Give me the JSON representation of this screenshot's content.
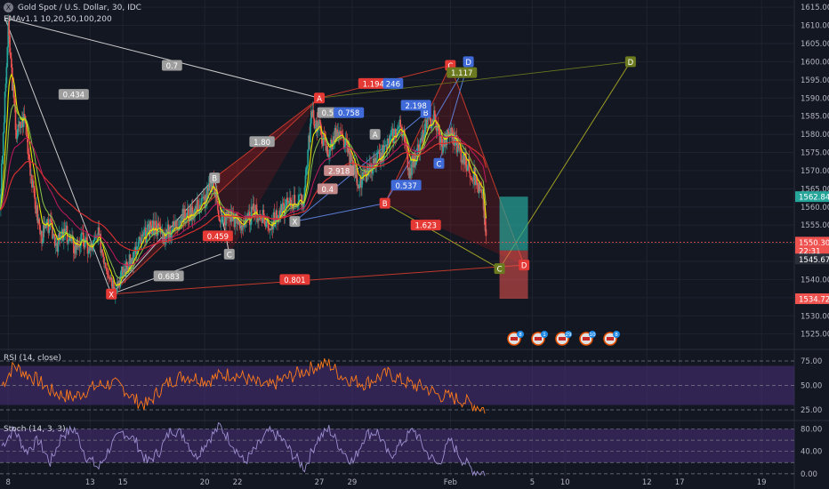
{
  "header": {
    "symbol_line": "Gold Spot / U.S. Dollar, 30, IDC",
    "symbol_logo_letter": "X",
    "ema_line": "EMAv1.1 10,20,50,100,200"
  },
  "colors": {
    "background": "#131722",
    "bull": "#26a69a",
    "bear": "#ef5350",
    "ema_fast": "#e6e600",
    "ema_mid": "#8bc34a",
    "ema_slow": "#d32f2f",
    "rsi_line": "#ff7a1a",
    "stoch_line": "#9c8fd0",
    "band": "#4a2f7a"
  },
  "chart_data": [
    {
      "type": "line",
      "title": "Gold Spot / U.S. Dollar, 30, IDC",
      "y_axis_ticks": [
        1525,
        1530,
        1535,
        1540,
        1545,
        1550,
        1555,
        1560,
        1565,
        1570,
        1575,
        1580,
        1585,
        1590,
        1595,
        1600,
        1605,
        1610,
        1615
      ],
      "y_axis_tick_labels": [
        "1525.00",
        "1530.00",
        "1535.00",
        "1540.00",
        "1545.00",
        "1550.00",
        "1555.00",
        "1560.00",
        "1565.00",
        "1570.00",
        "1575.00",
        "1580.00",
        "1585.00",
        "1590.00",
        "1595.00",
        "1600.00",
        "1605.00",
        "1610.00",
        "1615.00"
      ],
      "ylim": [
        1521,
        1617
      ],
      "x_axis_ticks": [
        8,
        13,
        15,
        20,
        22,
        27,
        29,
        35,
        40,
        42,
        47,
        49,
        54
      ],
      "x_axis_tick_labels": [
        "8",
        "13",
        "15",
        "20",
        "22",
        "27",
        "29",
        "Feb",
        "5",
        "10",
        "12",
        "17",
        "19"
      ],
      "xlim": [
        7.5,
        56
      ],
      "price_close": [
        [
          7.5,
          1560
        ],
        [
          8,
          1609
        ],
        [
          8.5,
          1580
        ],
        [
          9,
          1585
        ],
        [
          9.5,
          1565
        ],
        [
          10,
          1552
        ],
        [
          10.5,
          1555
        ],
        [
          11,
          1550
        ],
        [
          11.5,
          1553
        ],
        [
          12,
          1549
        ],
        [
          12.5,
          1551
        ],
        [
          13,
          1548
        ],
        [
          13.5,
          1552
        ],
        [
          14,
          1544
        ],
        [
          14.5,
          1538
        ],
        [
          15,
          1542
        ],
        [
          15.5,
          1545
        ],
        [
          16,
          1550
        ],
        [
          16.5,
          1553
        ],
        [
          17,
          1555
        ],
        [
          17.5,
          1552
        ],
        [
          18,
          1554
        ],
        [
          18.5,
          1557
        ],
        [
          19,
          1558
        ],
        [
          19.5,
          1560
        ],
        [
          20,
          1562
        ],
        [
          20.5,
          1567
        ],
        [
          21,
          1556
        ],
        [
          21.5,
          1558
        ],
        [
          22,
          1556
        ],
        [
          22.5,
          1555
        ],
        [
          23,
          1559
        ],
        [
          23.5,
          1557
        ],
        [
          24,
          1555
        ],
        [
          24.5,
          1558
        ],
        [
          25,
          1560
        ],
        [
          25.5,
          1562
        ],
        [
          26,
          1561
        ],
        [
          26.5,
          1585
        ],
        [
          27,
          1582
        ],
        [
          27.5,
          1575
        ],
        [
          28,
          1580
        ],
        [
          28.5,
          1578
        ],
        [
          29,
          1572
        ],
        [
          29.5,
          1566
        ],
        [
          30,
          1570
        ],
        [
          30.5,
          1572
        ],
        [
          31,
          1576
        ],
        [
          31.5,
          1580
        ],
        [
          32,
          1583
        ],
        [
          32.5,
          1570
        ],
        [
          33,
          1575
        ],
        [
          33.5,
          1582
        ],
        [
          34,
          1585
        ],
        [
          34.5,
          1577
        ],
        [
          35,
          1581
        ],
        [
          35.5,
          1576
        ],
        [
          36,
          1572
        ],
        [
          36.5,
          1568
        ],
        [
          37,
          1562
        ],
        [
          37.2,
          1551
        ]
      ],
      "series": [
        {
          "name": "RSI (14, close)",
          "panel": "rsi",
          "levels": [
            25,
            50,
            75
          ],
          "band": [
            30,
            70
          ],
          "ylim": [
            15,
            85
          ],
          "values": [
            50,
            70,
            62,
            55,
            45,
            40,
            38,
            45,
            50,
            52,
            48,
            35,
            30,
            45,
            55,
            60,
            58,
            55,
            60,
            62,
            58,
            52,
            48,
            55,
            60,
            65,
            70,
            72,
            60,
            55,
            52,
            58,
            62,
            55,
            50,
            48,
            40,
            38,
            35,
            30,
            25
          ]
        },
        {
          "name": "Stoch (14, 3, 3)",
          "panel": "stoch",
          "levels": [
            0,
            20,
            40,
            60,
            80
          ],
          "band": [
            20,
            80
          ],
          "ylim": [
            -5,
            92
          ],
          "values": [
            50,
            80,
            40,
            60,
            20,
            70,
            80,
            30,
            10,
            50,
            75,
            60,
            20,
            40,
            80,
            70,
            30,
            60,
            85,
            55,
            20,
            45,
            75,
            65,
            35,
            10,
            60,
            80,
            45,
            20,
            70,
            75,
            30,
            55,
            80,
            40,
            15,
            60,
            25,
            5,
            2
          ]
        }
      ],
      "rsi_axis_labels": [
        "75.00",
        "50.00",
        "25.00"
      ],
      "stoch_axis_labels": [
        "80.00",
        "40.00",
        "0.00"
      ],
      "current_price_labels": [
        {
          "text": "1562.84",
          "price": 1562.84,
          "color": "#26a69a"
        },
        {
          "text": "1550.30",
          "price": 1550.3,
          "color": "#ef5350"
        },
        {
          "text": "22:31",
          "price": 1548.0,
          "color": "#ef5350"
        },
        {
          "text": "1545.67",
          "price": 1545.67,
          "color": "#2a2e39"
        },
        {
          "text": "1534.72",
          "price": 1534.72,
          "color": "#ef5350"
        }
      ],
      "harmonic_points": [
        {
          "label": "X",
          "x": 14.3,
          "y": 1536,
          "color": "#e53935"
        },
        {
          "label": "A",
          "x": 27.0,
          "y": 1590,
          "color": "#e53935"
        },
        {
          "label": "B",
          "x": 20.6,
          "y": 1568,
          "color": "#9e9e9e"
        },
        {
          "label": "C",
          "x": 21.5,
          "y": 1547,
          "color": "#9e9e9e"
        },
        {
          "label": "X",
          "x": 25.5,
          "y": 1556,
          "color": "#9e9e9e"
        },
        {
          "label": "A",
          "x": 30.4,
          "y": 1580,
          "color": "#9e9e9e"
        },
        {
          "label": "B",
          "x": 31.0,
          "y": 1561,
          "color": "#e53935"
        },
        {
          "label": "B",
          "x": 33.5,
          "y": 1586,
          "color": "#3f6ad8"
        },
        {
          "label": "C",
          "x": 34.3,
          "y": 1572,
          "color": "#3f6ad8"
        },
        {
          "label": "C",
          "x": 35.0,
          "y": 1599,
          "color": "#e53935"
        },
        {
          "label": "D",
          "x": 36.1,
          "y": 1600,
          "color": "#3f6ad8"
        },
        {
          "label": "C",
          "x": 38.0,
          "y": 1543,
          "color": "#6b7a1e"
        },
        {
          "label": "D",
          "x": 39.5,
          "y": 1544,
          "color": "#e53935"
        },
        {
          "label": "D",
          "x": 46.0,
          "y": 1600,
          "color": "#6b7a1e"
        }
      ],
      "ratio_labels": [
        {
          "text": "0.7",
          "x": 18.0,
          "y": 1599,
          "color": "#9e9e9e"
        },
        {
          "text": "0.434",
          "x": 12.0,
          "y": 1591,
          "color": "#9e9e9e"
        },
        {
          "text": "1.80",
          "x": 23.5,
          "y": 1578,
          "color": "#9e9e9e"
        },
        {
          "text": "0.683",
          "x": 17.8,
          "y": 1541,
          "color": "#9e9e9e"
        },
        {
          "text": "0.459",
          "x": 20.8,
          "y": 1552,
          "color": "#e53935"
        },
        {
          "text": "0.801",
          "x": 25.5,
          "y": 1540,
          "color": "#e53935"
        },
        {
          "text": "0.506",
          "x": 27.8,
          "y": 1586,
          "color": "#9e9e9e"
        },
        {
          "text": "0.758",
          "x": 28.8,
          "y": 1586,
          "color": "#3f6ad8"
        },
        {
          "text": "1.194",
          "x": 30.3,
          "y": 1594,
          "color": "#e53935"
        },
        {
          "text": "246",
          "x": 31.5,
          "y": 1594,
          "color": "#3f6ad8"
        },
        {
          "text": "2.198",
          "x": 32.9,
          "y": 1588,
          "color": "#3f6ad8"
        },
        {
          "text": "0.537",
          "x": 32.3,
          "y": 1566,
          "color": "#3f6ad8"
        },
        {
          "text": "2.918",
          "x": 28.2,
          "y": 1570,
          "color": "#c48a8a"
        },
        {
          "text": "0.4",
          "x": 27.5,
          "y": 1565,
          "color": "#c48a8a"
        },
        {
          "text": "1.623",
          "x": 33.5,
          "y": 1555,
          "color": "#e53935"
        },
        {
          "text": "1.117",
          "x": 35.7,
          "y": 1597,
          "color": "#6b7a1e"
        }
      ],
      "event_icons": [
        "8",
        "1",
        "29",
        "10",
        "8"
      ]
    }
  ]
}
